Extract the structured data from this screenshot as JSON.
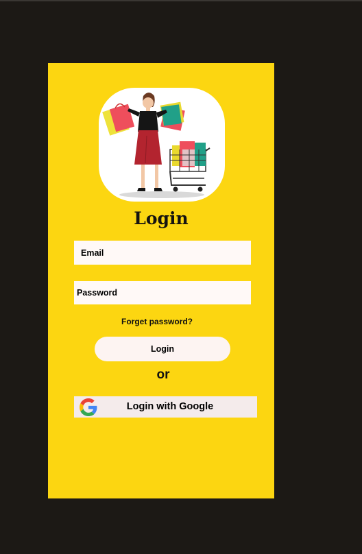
{
  "login": {
    "title": "Login",
    "email": {
      "placeholder": "Email"
    },
    "password": {
      "placeholder": "Password"
    },
    "forgot_label": "Forget password?",
    "submit_label": "Login",
    "divider_label": "or",
    "google_label": "Login with Google"
  },
  "icons": {
    "google": "google-logo-icon",
    "illustration": "shopping-woman-illustration"
  },
  "colors": {
    "background": "#1c1915",
    "card": "#fcd611",
    "field": "#fff9f7",
    "google_button": "#f4ebeb"
  }
}
